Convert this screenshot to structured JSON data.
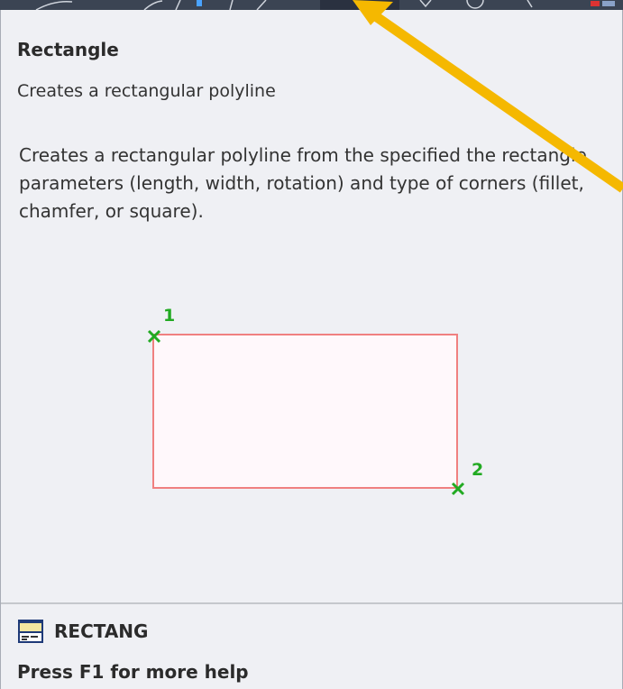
{
  "tooltip": {
    "title": "Rectangle",
    "summary": "Creates a rectangular polyline",
    "description": "Creates a rectangular polyline from the specified the rectangle parameters (length, width, rotation) and type of corners (fillet, chamfer, or square).",
    "illustration": {
      "point_1_label": "1",
      "point_2_label": "2",
      "rectangle_stroke": "#f08080",
      "rectangle_fill": "#fff8fb",
      "marker_color": "#22aa22"
    },
    "command": {
      "icon": "command-line-icon",
      "name": "RECTANG"
    },
    "help_hint": "Press F1 for more help"
  },
  "colors": {
    "annotation_arrow": "#f5b800",
    "toolbar_background": "#3b4453"
  }
}
